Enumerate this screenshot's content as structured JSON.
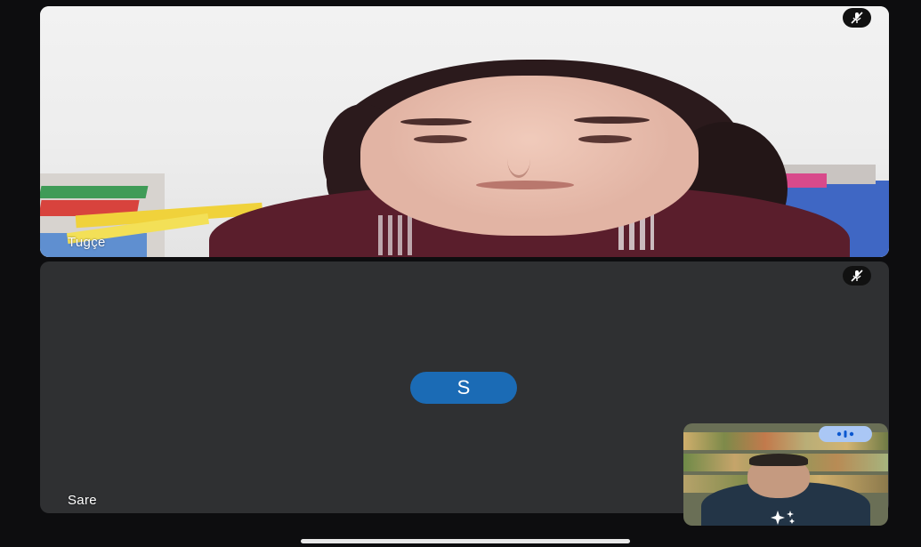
{
  "participants": [
    {
      "name": "Tugçe",
      "muted": true,
      "video": "on"
    },
    {
      "name": "Sare",
      "muted": true,
      "video": "off",
      "avatar_letter": "S"
    }
  ],
  "self_view": {
    "video": "on"
  },
  "icons": {
    "mute": "mic-off-icon",
    "audio_level": "audio-level-icon",
    "effects": "sparkle-effects-icon"
  },
  "colors": {
    "background": "#0d0d0f",
    "tile_off": "#2f3032",
    "avatar": "#1b6bb5",
    "audio_pill": "#aac7f5"
  }
}
